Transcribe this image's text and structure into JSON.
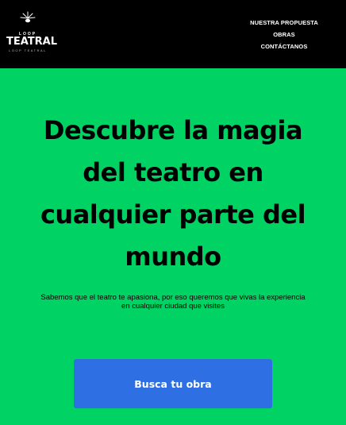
{
  "header": {
    "logo": {
      "small_text": "LOOP",
      "main_text": "TEATRAL",
      "sub_text": "LOOP TEATRAL",
      "icon": "spotlight-rays-icon"
    },
    "nav": [
      {
        "label": "NUESTRA PROPUESTA"
      },
      {
        "label": "OBRAS"
      },
      {
        "label": "CONTÁCTANOS"
      }
    ]
  },
  "hero": {
    "title": "Descubre la magia del teatro en cualquier parte del mundo",
    "subtitle": "Sabemos que el teatro te apasiona, por eso queremos que vivas la experiencia en cualquier ciudad que visites",
    "cta_label": "Busca tu obra"
  },
  "colors": {
    "background": "#00d264",
    "header": "#000000",
    "cta": "#2f6fe4",
    "text": "#000000",
    "nav_text": "#ffffff"
  }
}
